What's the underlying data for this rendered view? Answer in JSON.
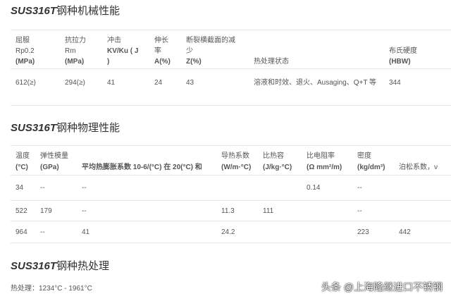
{
  "mech": {
    "title_model": "SUS316T",
    "title_rest": "钢种机械性能",
    "headers": [
      [
        "屈服",
        "Rp0.2",
        "(MPa)"
      ],
      [
        "抗拉力",
        "Rm",
        "(MPa)"
      ],
      [
        "冲击",
        "KV/Ku ( J",
        ")"
      ],
      [
        "伸长",
        "率",
        "A(%)"
      ],
      [
        "断裂横截面的减",
        "少",
        "Z(%)"
      ],
      [
        "热处理状态"
      ],
      [
        "布氏硬度",
        "(HBW)"
      ]
    ],
    "row": [
      "612(≥)",
      "294(≥)",
      "41",
      "24",
      "43",
      "溶液和时效、退火、Ausaging、Q+T 等",
      "344"
    ]
  },
  "phys": {
    "title_model": "SUS316T",
    "title_rest": "钢种物理性能",
    "headers": [
      [
        "温度",
        "(°C)"
      ],
      [
        "弹性模量",
        "(GPa)"
      ],
      [
        "平均热膨胀系数 10-6/(°C) 在 20(°C) 和"
      ],
      [
        "导热系数",
        "(W/m·°C)"
      ],
      [
        "比热容",
        "(J/kg·°C)"
      ],
      [
        "比电阻率",
        "(Ω mm²/m)"
      ],
      [
        "密度",
        "(kg/dm³)"
      ],
      [
        "泊松系数，ν"
      ]
    ],
    "rows": [
      [
        "34",
        "--",
        "--",
        "",
        "",
        "0.14",
        "--",
        ""
      ],
      [
        "522",
        "179",
        "--",
        "11.3",
        "111",
        "",
        "--",
        ""
      ],
      [
        "964",
        "--",
        "41",
        "24.2",
        "",
        "",
        "223",
        "442"
      ]
    ]
  },
  "heat": {
    "title_model": "SUS316T",
    "title_rest": "钢种热处理",
    "text": "热处理：1234°C - 1961°C"
  },
  "watermark": "头条 @上海隆继进口不锈钢"
}
